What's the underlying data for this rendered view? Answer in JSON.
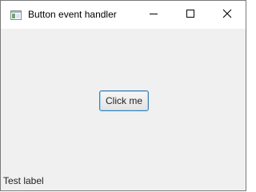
{
  "window": {
    "title": "Button event handler"
  },
  "titlebar": {
    "icons": {
      "app": "app-window-icon",
      "minimize": "minimize-icon",
      "maximize": "maximize-icon",
      "close": "close-icon"
    }
  },
  "content": {
    "button_label": "Click me",
    "label_text": "Test label"
  },
  "colors": {
    "titlebar_bg": "#ffffff",
    "content_bg": "#f0f0f0",
    "button_focus_border": "#3c7fb1",
    "text": "#222222"
  }
}
